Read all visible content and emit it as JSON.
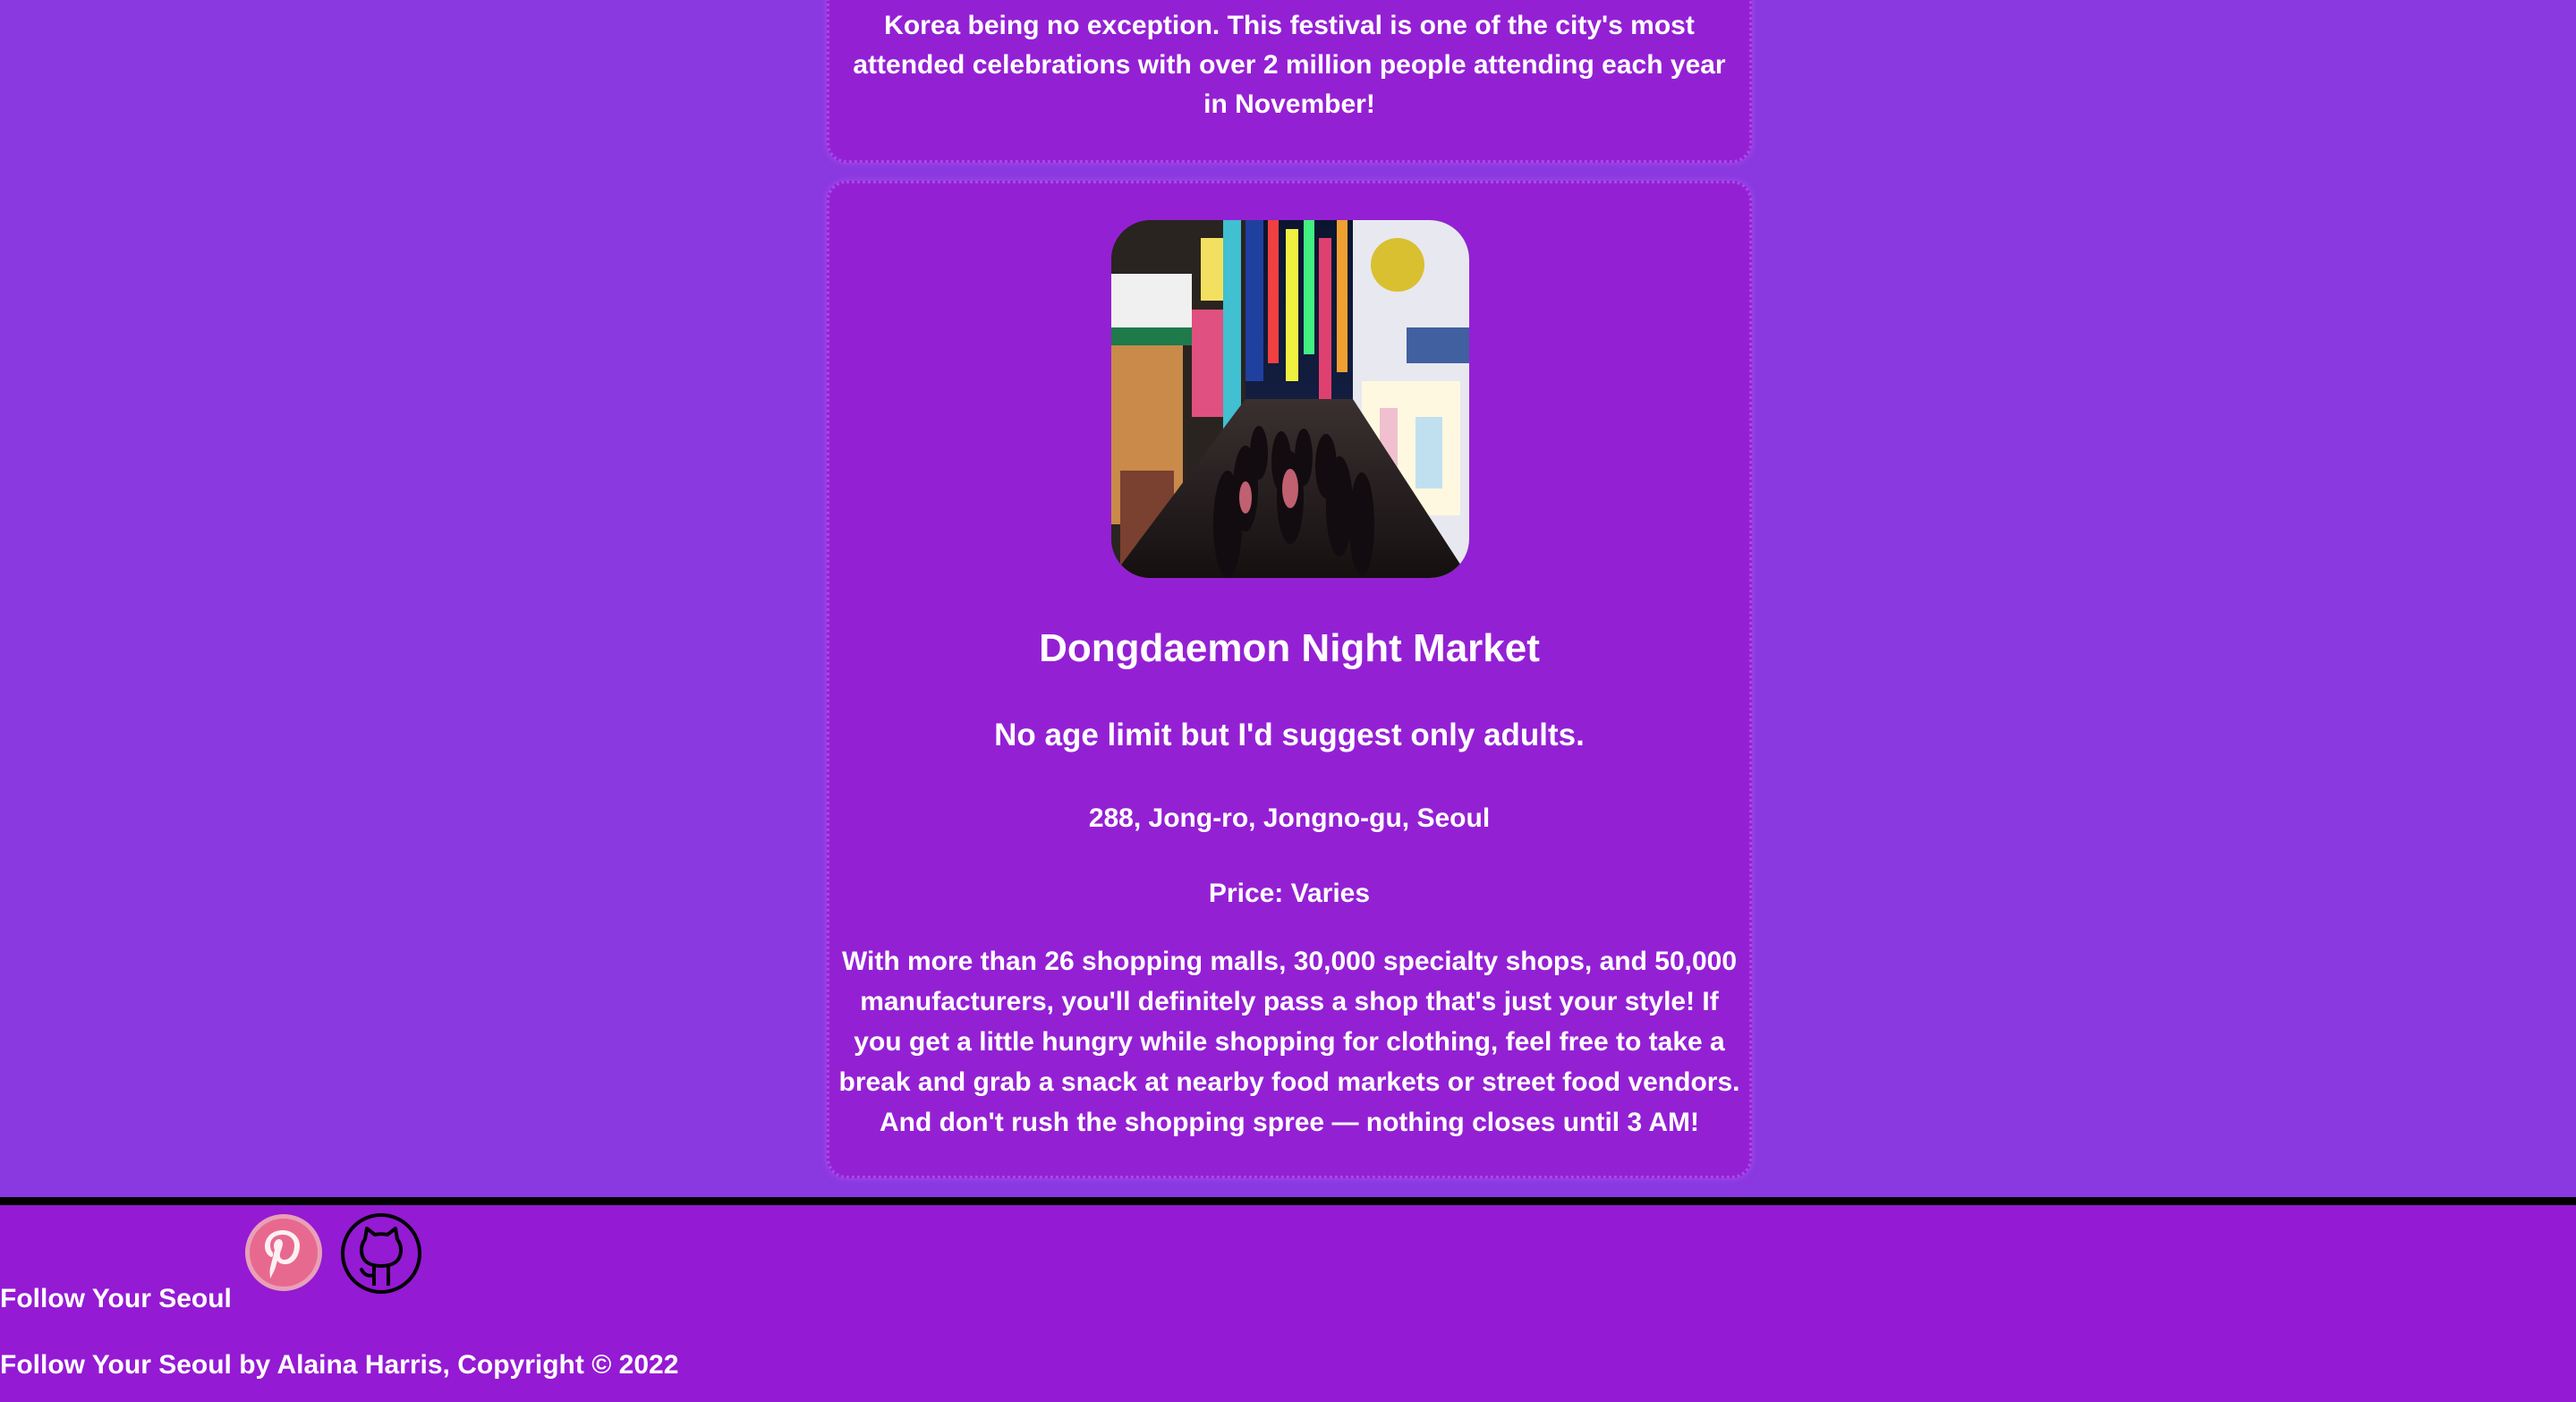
{
  "previous_card": {
    "text": "Korea being no exception. This festival is one of the city's most attended celebrations with over 2 million people attending each year in November!"
  },
  "market_card": {
    "image_icon": "night-market-street-photo",
    "title": "Dongdaemon Night Market",
    "age": "No age limit but I'd suggest only adults.",
    "address": "288, Jong-ro, Jongno-gu, Seoul",
    "price": "Price: Varies",
    "description": "With more than 26 shopping malls, 30,000 specialty shops, and 50,000 manufacturers, you'll definitely pass a shop that's just your style! If you get a little hungry while shopping for clothing, feel free to take a break and grab a snack at nearby food markets or street food vendors. And don't rush the shopping spree — nothing closes until 3 AM!"
  },
  "footer": {
    "follow_label": "Follow Your Seoul",
    "social": [
      {
        "name": "pinterest",
        "icon": "pinterest-icon",
        "color": "#e8698f"
      },
      {
        "name": "github",
        "icon": "github-icon",
        "color": "#000000"
      }
    ],
    "copyright": "Follow Your Seoul by Alaina Harris, Copyright © 2022"
  },
  "colors": {
    "page_background": "#8a38e0",
    "card_background": "#9420d4",
    "footer_background": "#941ad4",
    "footer_border": "#000000",
    "text": "#ffffff"
  }
}
